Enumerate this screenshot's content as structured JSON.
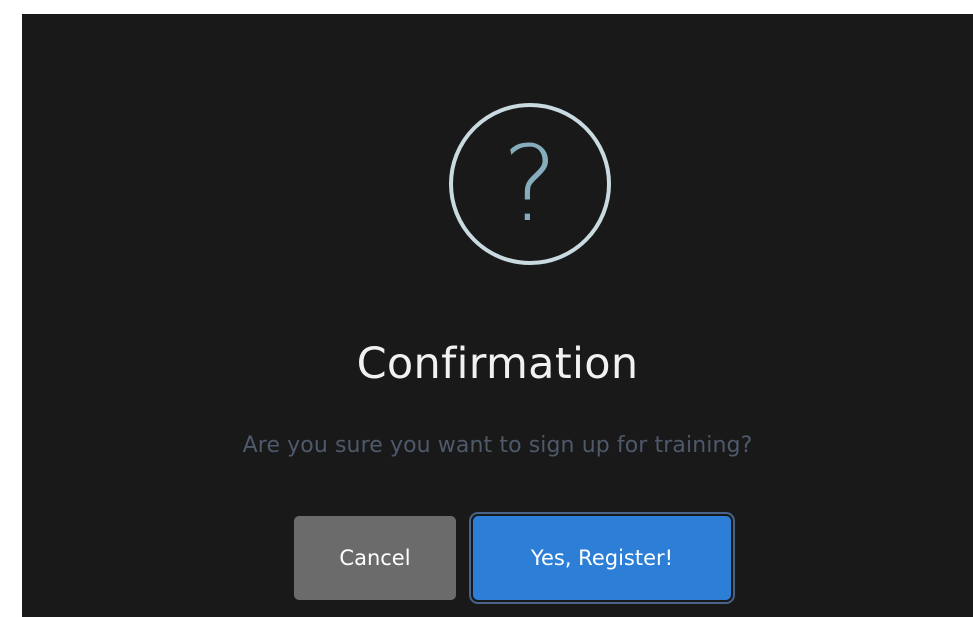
{
  "dialog": {
    "icon": "question-mark-icon",
    "icon_glyph": "?",
    "title": "Confirmation",
    "message": "Are you sure you want to sign up for training?",
    "cancel_label": "Cancel",
    "confirm_label": "Yes, Register!"
  },
  "colors": {
    "background": "#19191a",
    "icon_ring": "#c9dae1",
    "icon_glyph": "#87adbd",
    "title_text": "#f1f1f1",
    "message_text": "#4e596a",
    "cancel_button": "#6b6b6b",
    "confirm_button": "#2c7ed6",
    "confirm_focus_ring": "#47638a"
  }
}
